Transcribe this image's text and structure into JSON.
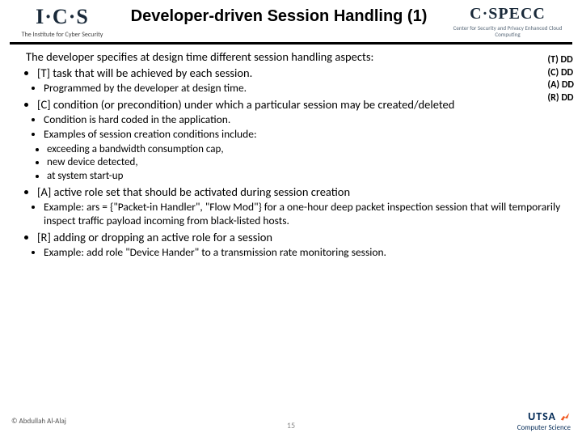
{
  "header": {
    "left_logo_text": "I·C·S",
    "left_logo_sub": "The Institute for Cyber Security",
    "title": "Developer-driven Session Handling (1)",
    "right_logo_text": "C·SPECC",
    "right_logo_sub": "Center for Security and Privacy Enhanced Cloud Computing"
  },
  "intro": "The developer specifies at design time different session handling aspects:",
  "sidebox": [
    "(T) DD",
    "(C) DD",
    "(A) DD",
    "(R) DD"
  ],
  "items": {
    "t": "[T] task that will be achieved by each session.",
    "t_sub": [
      "Programmed by the developer at design time."
    ],
    "c": "[C] condition (or precondition) under which a particular session may be created/deleted",
    "c_sub": [
      "Condition is hard coded in the application.",
      "Examples of session creation conditions include:"
    ],
    "c_sub2": [
      "exceeding a bandwidth consumption cap,",
      "new device detected,",
      "at system start-up"
    ],
    "a": "[A] active role set that should be activated during session creation",
    "a_sub": [
      "Example: ars = {\"Packet-in Handler\", \"Flow Mod\"} for a one-hour deep packet inspection session that will temporarily inspect traffic payload incoming from black-listed hosts."
    ],
    "r": "[R] adding or dropping an active role for a session",
    "r_sub": [
      "Example: add role \"Device Hander\" to a transmission rate monitoring session."
    ]
  },
  "footer": {
    "copyright": "© Abdullah Al-Alaj",
    "page": "15",
    "utsa": "UTSA",
    "utsa_sub": "Computer Science"
  }
}
